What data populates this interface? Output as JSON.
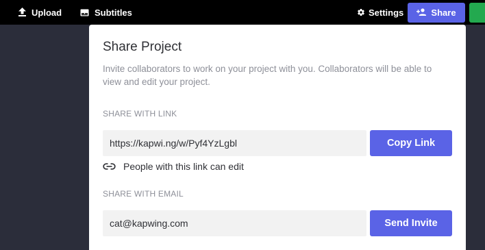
{
  "topbar": {
    "upload_label": "Upload",
    "upload_icon": "upload-icon",
    "subtitles_label": "Subtitles",
    "subtitles_icon": "subtitles-icon",
    "settings_label": "Settings",
    "settings_icon": "gear-icon",
    "share_label": "Share",
    "share_icon": "add-person-icon",
    "share_color": "#5a63e6",
    "extra_button_color": "#23a94f"
  },
  "modal": {
    "title": "Share Project",
    "description": "Invite collaborators to work on your project with you. Collaborators will be able to view and edit your project.",
    "link_section": {
      "label": "SHARE WITH LINK",
      "url": "https://kapwi.ng/w/Pyf4YzLgbl",
      "copy_label": "Copy Link",
      "note_icon": "link-icon",
      "note": "People with this link can edit"
    },
    "email_section": {
      "label": "SHARE WITH EMAIL",
      "email": "cat@kapwing.com",
      "invite_label": "Send Invite"
    },
    "accent_color": "#5a63e6"
  }
}
